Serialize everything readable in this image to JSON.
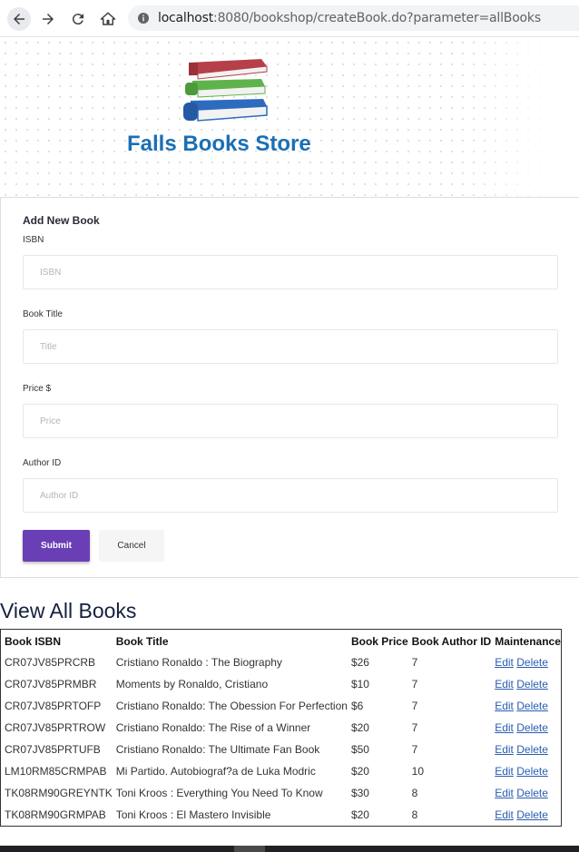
{
  "browser": {
    "url_host": "localhost",
    "url_rest": ":8080/bookshop/createBook.do?parameter=allBooks"
  },
  "header": {
    "store_name": "Falls Books Store",
    "colors": {
      "brand": "#1a6fb5",
      "book_red": "#b5404a",
      "book_green": "#5fb34a",
      "book_blue": "#2d6bbf"
    }
  },
  "form": {
    "title": "Add New Book",
    "fields": [
      {
        "label": "ISBN",
        "placeholder": "ISBN",
        "value": ""
      },
      {
        "label": "Book Title",
        "placeholder": "Title",
        "value": ""
      },
      {
        "label": "Price $",
        "placeholder": "Price",
        "value": ""
      },
      {
        "label": "Author ID",
        "placeholder": "Author ID",
        "value": ""
      }
    ],
    "submit_label": "Submit",
    "cancel_label": "Cancel",
    "accent": "#6a3fb5"
  },
  "books": {
    "title": "View All Books",
    "columns": [
      "Book ISBN",
      "Book Title",
      "Book Price",
      "Book Author ID",
      "Maintenance"
    ],
    "edit_label": "Edit",
    "delete_label": "Delete",
    "rows": [
      {
        "isbn": "CR07JV85PRCRB",
        "title": "Cristiano Ronaldo : The Biography",
        "price": "$26",
        "author_id": "7"
      },
      {
        "isbn": "CR07JV85PRMBR",
        "title": "Moments by Ronaldo, Cristiano",
        "price": "$10",
        "author_id": "7"
      },
      {
        "isbn": "CR07JV85PRTOFP",
        "title": "Cristiano Ronaldo: The Obession For Perfection",
        "price": "$6",
        "author_id": "7"
      },
      {
        "isbn": "CR07JV85PRTROW",
        "title": "Cristiano Ronaldo: The Rise of a Winner",
        "price": "$20",
        "author_id": "7"
      },
      {
        "isbn": "CR07JV85PRTUFB",
        "title": "Cristiano Ronaldo: The Ultimate Fan Book",
        "price": "$50",
        "author_id": "7"
      },
      {
        "isbn": "LM10RM85CRMPAB",
        "title": "Mi Partido. Autobiograf?a de Luka Modric",
        "price": "$20",
        "author_id": "10"
      },
      {
        "isbn": "TK08RM90GREYNTK",
        "title": "Toni Kroos : Everything You Need To Know",
        "price": "$30",
        "author_id": "8"
      },
      {
        "isbn": "TK08RM90GRMPAB",
        "title": "Toni Kroos : El Mastero Invisible",
        "price": "$20",
        "author_id": "8"
      }
    ]
  }
}
